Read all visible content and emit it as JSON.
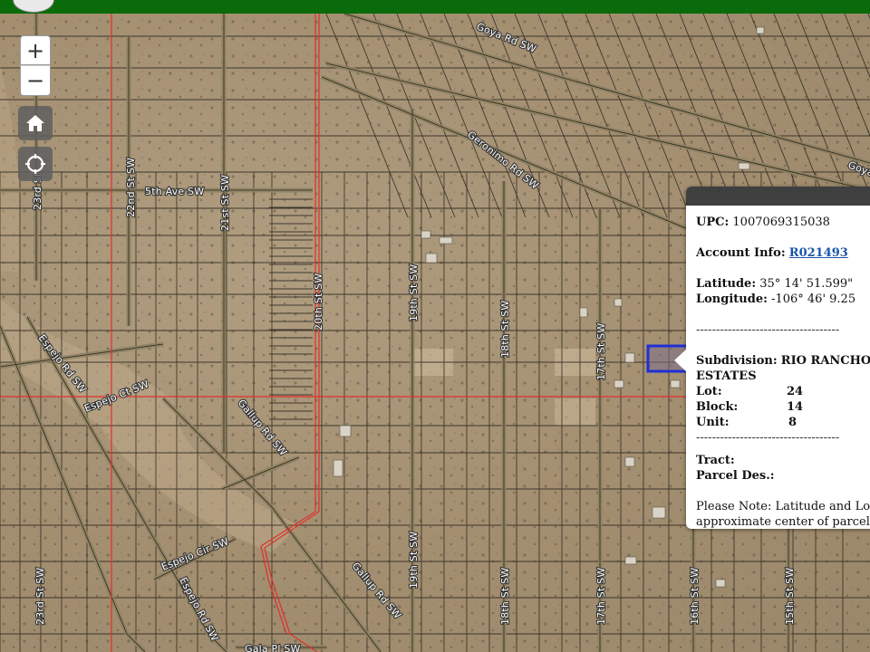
{
  "map": {
    "roads": [
      {
        "id": "goya-1",
        "label": "Goya Rd SW"
      },
      {
        "id": "goya-2",
        "label": "Goya"
      },
      {
        "id": "geronimo",
        "label": "Geronimo Rd SW"
      },
      {
        "id": "fifth-ave",
        "label": "5th Ave SW"
      },
      {
        "id": "23rd-top",
        "label": "23rd St"
      },
      {
        "id": "22nd",
        "label": "22nd St SW"
      },
      {
        "id": "21st",
        "label": "21st St SW"
      },
      {
        "id": "20th",
        "label": "20th St SW"
      },
      {
        "id": "19th-top",
        "label": "19th St SW"
      },
      {
        "id": "18th-top",
        "label": "18th St SW"
      },
      {
        "id": "17th-top",
        "label": "17th St SW"
      },
      {
        "id": "espejo-rd-1",
        "label": "Espejo Rd SW"
      },
      {
        "id": "espejo-ct",
        "label": "Espejo Ct SW"
      },
      {
        "id": "gallup-1",
        "label": "Gallup Rd SW"
      },
      {
        "id": "gallup-2",
        "label": "Gallup Rd SW"
      },
      {
        "id": "espejo-cir",
        "label": "Espejo Cir SW"
      },
      {
        "id": "espejo-rd-2",
        "label": "Espejo Rd SW"
      },
      {
        "id": "23rd-bottom",
        "label": "23rd St SW"
      },
      {
        "id": "19th-bottom",
        "label": "19th St SW"
      },
      {
        "id": "18th-bottom",
        "label": "18th St SW"
      },
      {
        "id": "17th-bottom",
        "label": "17th St SW"
      },
      {
        "id": "16th",
        "label": "16th St SW"
      },
      {
        "id": "15th",
        "label": "15th St SW"
      },
      {
        "id": "gala",
        "label": "Gala Pl SW"
      }
    ],
    "colors": {
      "highlight": "#1f2fd6",
      "boundary": "#e0302b",
      "header": "#0a6b0a"
    }
  },
  "controls": {
    "zoom_in": "+",
    "zoom_out": "−",
    "home_icon": "home-icon",
    "locate_icon": "locate-icon"
  },
  "popup": {
    "upc_label": "UPC:",
    "upc_value": "1007069315038",
    "account_label": "Account Info:",
    "account_link": "R021493",
    "latitude_label": "Latitude:",
    "latitude_value": "35° 14' 51.599\"",
    "longitude_label": "Longitude:",
    "longitude_value": "-106° 46' 9.25",
    "separator": "------------------------------------",
    "subdivision_label": "Subdivision:",
    "subdivision_value": "RIO RANCHO",
    "subdivision_value_2": "ESTATES",
    "lot_label": "Lot:",
    "lot_value": "24",
    "block_label": "Block:",
    "block_value": "14",
    "unit_label": "Unit:",
    "unit_value": "8",
    "separator2": "------------------------------------",
    "tract_label": "Tract:",
    "parcel_label": "Parcel Des.:",
    "note": "Please Note: Latitude and Lo is the approximate center of parcel shown."
  }
}
